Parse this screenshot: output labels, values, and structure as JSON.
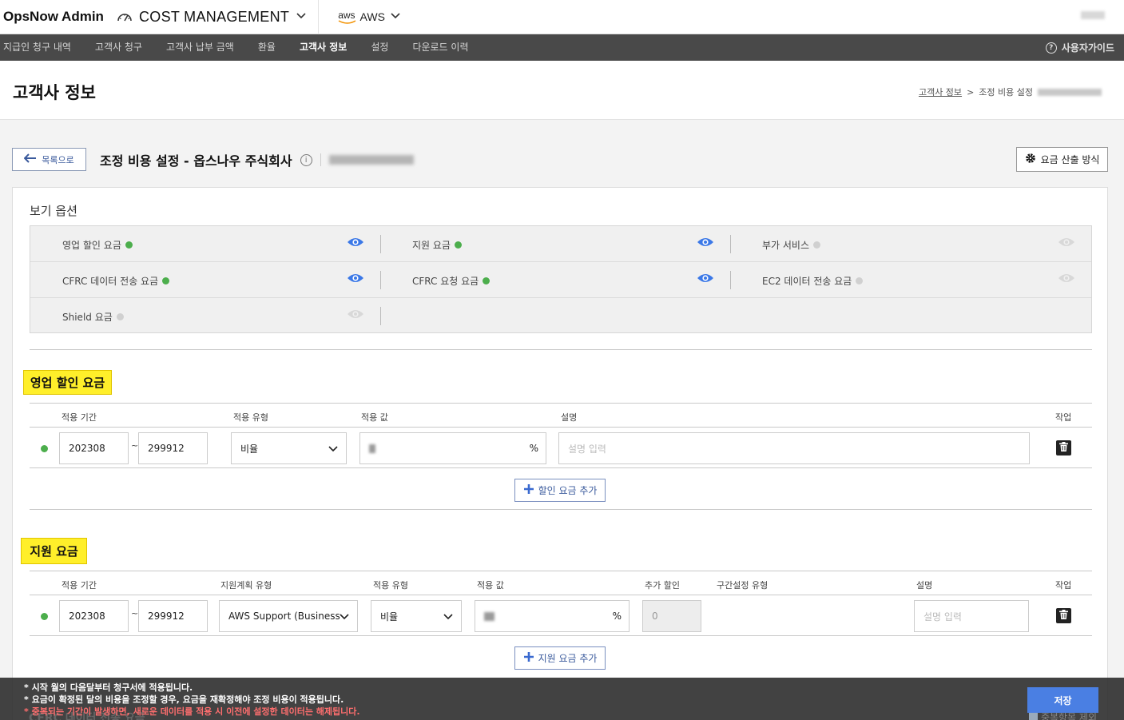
{
  "header": {
    "brand": "OpsNow Admin",
    "product": "COST MANAGEMENT",
    "cloud_logo": "aws",
    "cloud": "AWS"
  },
  "nav": {
    "items": [
      "지급인 청구 내역",
      "고객사 청구",
      "고객사 납부 금액",
      "환율",
      "고객사 정보",
      "설정",
      "다운로드 이력"
    ],
    "active_index": 4,
    "guide": "사용자가이드"
  },
  "page": {
    "title": "고객사 정보",
    "breadcrumb_link": "고객사 정보",
    "breadcrumb_sep": ">",
    "breadcrumb_current": "조정 비용 설정"
  },
  "subheader": {
    "back": "목록으로",
    "title": "조정 비용 설정 - 옵스나우 주식회사",
    "calc_method": "요금 산출 방식"
  },
  "view_options": {
    "title": "보기 옵션",
    "items": [
      {
        "label": "영업 할인 요금",
        "enabled": true
      },
      {
        "label": "지원 요금",
        "enabled": true
      },
      {
        "label": "부가 서비스",
        "enabled": false
      },
      {
        "label": "CFRC 데이터 전송 요금",
        "enabled": true
      },
      {
        "label": "CFRC 요청 요금",
        "enabled": true
      },
      {
        "label": "EC2 데이터 전송 요금",
        "enabled": false
      },
      {
        "label": "Shield 요금",
        "enabled": false
      }
    ]
  },
  "sales_discount": {
    "title": "영업 할인 요금",
    "headers": {
      "period": "적용 기간",
      "type": "적용 유형",
      "value": "적용 값",
      "desc": "설명",
      "action": "작업"
    },
    "row": {
      "start": "202308",
      "tilde": "~",
      "end": "299912",
      "type": "비율",
      "unit": "%",
      "desc_placeholder": "설명 입력"
    },
    "add": "할인 요금 추가"
  },
  "support": {
    "title": "지원 요금",
    "headers": {
      "period": "적용 기간",
      "plan": "지원계획 유형",
      "type": "적용 유형",
      "value": "적용 값",
      "extra": "추가 할인",
      "range": "구간설정 유형",
      "desc": "설명",
      "action": "작업"
    },
    "row": {
      "start": "202308",
      "tilde": "~",
      "end": "299912",
      "plan": "AWS Support (Business",
      "type": "비율",
      "unit": "%",
      "extra": "0",
      "desc_placeholder": "설명 입력"
    },
    "add": "지원 요금 추가"
  },
  "footer": {
    "note1": "* 시작 월의 다음달부터 청구서에 적용됩니다.",
    "note2": "* 요금이 확정된 달의 비용을 조정할 경우, 요금을 재확정해야 조정 비용이 적용됩니다.",
    "note3": "* 중복되는 기간이 발생하면, 새로운 데이터를 적용 시 이전에 설정한 데이터는 해제됩니다.",
    "save": "저장"
  },
  "peek_text": "CFRC 데이터 전송 요금",
  "peek_checkbox": "중복항목 제외",
  "colors": {
    "accent": "#4a7fe3",
    "eye_on": "#3b78e7",
    "dot_on": "#4cae4c",
    "highlight": "#ffef2a",
    "nav_bg": "#494949"
  }
}
